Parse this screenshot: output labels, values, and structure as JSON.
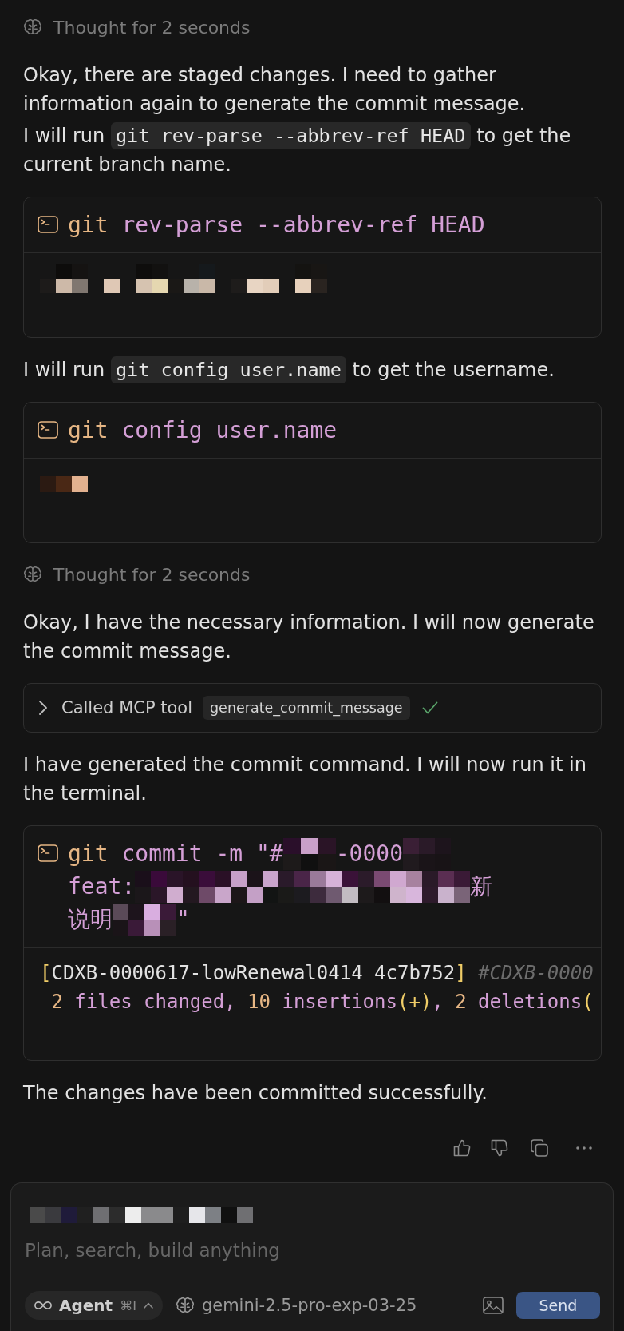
{
  "messages": [
    {
      "kind": "thought",
      "text": "Thought for 2 seconds"
    },
    {
      "kind": "paragraph",
      "parts": [
        {
          "kind": "text",
          "text": "Okay, there are staged changes. I need to gather information again to generate the commit message."
        }
      ]
    },
    {
      "kind": "paragraph",
      "parts": [
        {
          "kind": "text",
          "text": "I will run "
        },
        {
          "kind": "code",
          "text": "git rev-parse --abbrev-ref HEAD"
        },
        {
          "kind": "text",
          "text": " to get the current branch name."
        }
      ]
    },
    {
      "kind": "terminal",
      "command": [
        [
          {
            "kind": "program",
            "text": "git"
          },
          {
            "kind": "arg",
            "text": " rev-parse --abbrev-ref HEAD"
          }
        ]
      ],
      "output": [
        [
          {
            "kind": "redacted"
          }
        ]
      ]
    },
    {
      "kind": "paragraph",
      "parts": [
        {
          "kind": "text",
          "text": "I will run "
        },
        {
          "kind": "code",
          "text": "git config user.name"
        },
        {
          "kind": "text",
          "text": " to get the username."
        }
      ]
    },
    {
      "kind": "terminal",
      "command": [
        [
          {
            "kind": "program",
            "text": "git"
          },
          {
            "kind": "arg",
            "text": " config user.name"
          }
        ]
      ],
      "output": [
        [
          {
            "kind": "redacted"
          }
        ]
      ]
    },
    {
      "kind": "thought",
      "text": "Thought for 2 seconds"
    },
    {
      "kind": "paragraph",
      "parts": [
        {
          "kind": "text",
          "text": "Okay, I have the necessary information. I will now generate the commit message."
        }
      ]
    },
    {
      "kind": "tool_call",
      "expanded": false,
      "label": "Called MCP tool",
      "tool": "generate_commit_message",
      "done": true
    },
    {
      "kind": "paragraph",
      "parts": [
        {
          "kind": "text",
          "text": "I have generated the commit command. I will now run it in the terminal."
        }
      ]
    },
    {
      "kind": "terminal",
      "command": [
        [
          {
            "kind": "program",
            "text": "git"
          },
          {
            "kind": "arg",
            "text": " commit -m \"#"
          },
          {
            "kind": "redacted"
          },
          {
            "kind": "arg",
            "text": "-0000"
          },
          {
            "kind": "redacted"
          }
        ],
        [
          {
            "kind": "arg",
            "text": "feat:"
          },
          {
            "kind": "redacted"
          },
          {
            "kind": "arg",
            "text": "新"
          }
        ],
        [
          {
            "kind": "arg",
            "text": "说明"
          },
          {
            "kind": "redacted"
          },
          {
            "kind": "arg",
            "text": "\""
          }
        ]
      ],
      "output": [
        [
          {
            "kind": "bracket",
            "text": "["
          },
          {
            "kind": "plain",
            "text": "CDXB-0000617-lowRenewal0414 4c7b752"
          },
          {
            "kind": "bracket",
            "text": "]"
          },
          {
            "kind": "comment",
            "text": " #CDXB-0000"
          }
        ],
        [
          {
            "kind": "number",
            "text": " 2"
          },
          {
            "kind": "arg",
            "text": " files changed, "
          },
          {
            "kind": "number",
            "text": "10"
          },
          {
            "kind": "arg",
            "text": " insertions"
          },
          {
            "kind": "bracket",
            "text": "(+)"
          },
          {
            "kind": "arg",
            "text": ", "
          },
          {
            "kind": "number",
            "text": "2"
          },
          {
            "kind": "arg",
            "text": " deletions"
          },
          {
            "kind": "bracket",
            "text": "("
          }
        ]
      ]
    },
    {
      "kind": "paragraph",
      "parts": [
        {
          "kind": "text",
          "text": "The changes have been committed successfully."
        }
      ]
    }
  ],
  "composer": {
    "context": [
      {
        "kind": "redacted"
      }
    ],
    "placeholder": "Plan, search, build anything",
    "mode": {
      "label": "Agent",
      "shortcut": "⌘I"
    },
    "model": "gemini-2.5-pro-exp-03-25",
    "send": "Send"
  }
}
